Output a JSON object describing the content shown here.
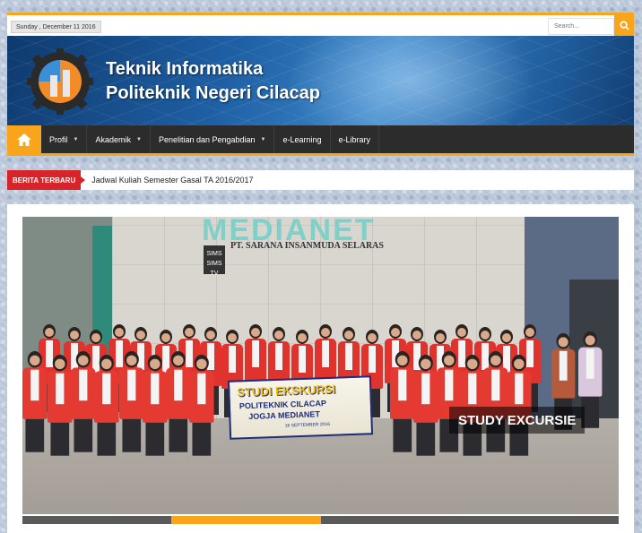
{
  "topbar": {
    "date": "Sunday , December 11 2016",
    "search_placeholder": "Search..."
  },
  "header": {
    "title_line1": "Teknik Informatika",
    "title_line2": "Politeknik Negeri Cilacap"
  },
  "nav": {
    "items": [
      {
        "label": "Profil",
        "has_dropdown": true
      },
      {
        "label": "Akademik",
        "has_dropdown": true
      },
      {
        "label": "Penelitian dan Pengabdian",
        "has_dropdown": true
      },
      {
        "label": "e-Learning",
        "has_dropdown": false
      },
      {
        "label": "e-Library",
        "has_dropdown": false
      }
    ]
  },
  "breaking": {
    "label": "BERITA TERBARU",
    "headline": "Jadwal Kuliah Semester Gasal TA 2016/2017"
  },
  "slider": {
    "caption": "STUDY EXCURSIE",
    "photo_sign": "MEDIANET",
    "photo_company": "PT. SARANA INSANMUDA SELARAS",
    "photo_sims": "SIMS",
    "photo_sims_tv": "SIMS TV",
    "banner_title": "STUDI EKSKURSI",
    "banner_line1": "POLITEKNIK CILACAP",
    "banner_line2": "JOGJA MEDIANET",
    "banner_date": "16 SEPTEMBER 2016",
    "slide_count": 4,
    "active_index": 2
  },
  "colors": {
    "accent": "#f8a51b",
    "nav_bg": "#2c2c2c",
    "breaking_red": "#d8232a"
  }
}
